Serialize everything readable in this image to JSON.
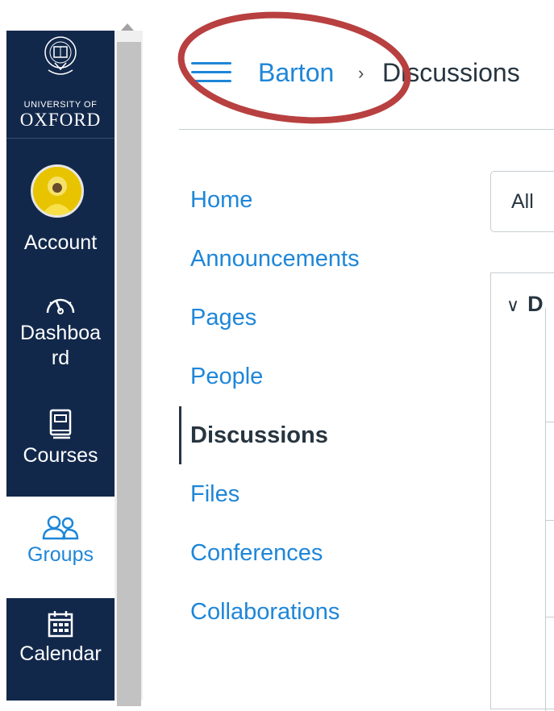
{
  "global_nav": {
    "logo": {
      "small_text": "UNIVERSITY OF",
      "big_text": "OXFORD"
    },
    "items": [
      {
        "label": "Account",
        "icon": "avatar"
      },
      {
        "label": "Dashboa\nrd",
        "icon": "dashboard-gauge-icon"
      },
      {
        "label": "Courses",
        "icon": "book-icon"
      },
      {
        "label": "Groups",
        "icon": "groups-icon",
        "active": true
      },
      {
        "label": "Calendar",
        "icon": "calendar-icon"
      }
    ]
  },
  "header": {
    "breadcrumb": {
      "course": "Barton",
      "separator": "›",
      "current": "Discussions"
    }
  },
  "course_nav": {
    "items": [
      {
        "label": "Home"
      },
      {
        "label": "Announcements"
      },
      {
        "label": "Pages"
      },
      {
        "label": "People"
      },
      {
        "label": "Discussions",
        "active": true
      },
      {
        "label": "Files"
      },
      {
        "label": "Conferences"
      },
      {
        "label": "Collaborations"
      }
    ]
  },
  "main": {
    "filter_select": {
      "value": "All"
    },
    "section_header": "D"
  },
  "colors": {
    "nav_bg": "#12284b",
    "link": "#1e86d8",
    "text": "#273540",
    "annotation": "#b84040"
  }
}
